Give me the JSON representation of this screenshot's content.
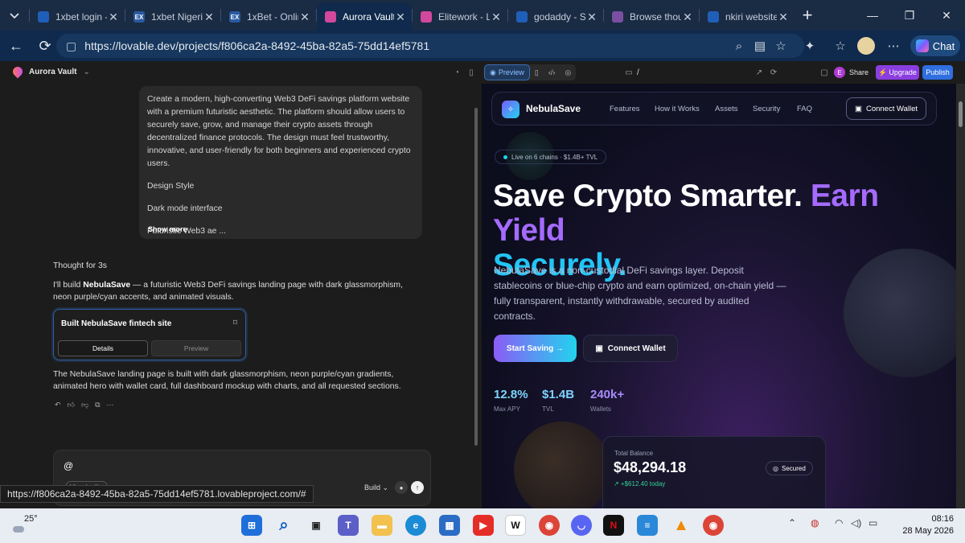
{
  "browser": {
    "tabs": [
      {
        "label": "1xbet login -",
        "fav_color": "#1f5fb8",
        "fav_text": "",
        "active": false
      },
      {
        "label": "1xbet Nigeria",
        "fav_color": "#2a5aa0",
        "fav_text": "EX",
        "active": false
      },
      {
        "label": "1xBet - Onlin",
        "fav_color": "#2a5aa0",
        "fav_text": "EX",
        "active": false
      },
      {
        "label": "Aurora Vault",
        "fav_color": "#d2489c",
        "fav_text": "",
        "active": true
      },
      {
        "label": "Elitework - Lo",
        "fav_color": "#d2489c",
        "fav_text": "",
        "active": false
      },
      {
        "label": "godaddy - Se",
        "fav_color": "#1f5fb8",
        "fav_text": "",
        "active": false
      },
      {
        "label": "Browse thous",
        "fav_color": "#7b4fa0",
        "fav_text": "",
        "active": false
      },
      {
        "label": "nkiri website",
        "fav_color": "#1f5fb8",
        "fav_text": "",
        "active": false
      }
    ],
    "url": "https://lovable.dev/projects/f806ca2a-8492-45ba-82a5-75dd14ef5781",
    "chat_label": "Chat",
    "status_url": "https://f806ca2a-8492-45ba-82a5-75dd14ef5781.lovableproject.com/#"
  },
  "app": {
    "project_name": "Aurora Vault",
    "preview_label": "Preview",
    "path": "/",
    "share_initial": "E",
    "share_label": "Share",
    "upgrade_label": "Upgrade",
    "publish_label": "Publish"
  },
  "chat": {
    "user_message": [
      "Create a modern, high-converting Web3 DeFi savings platform website with a premium futuristic aesthetic. The platform should allow users to securely save, grow, and manage their crypto assets through decentralized finance protocols. The design must feel trustworthy, innovative, and user-friendly for both beginners and experienced crypto users.",
      "Design Style",
      "Dark mode interface",
      "Futuristic Web3 ae ..."
    ],
    "show_more": "Show more",
    "thought": "Thought for 3s",
    "reply_prefix": "I'll build ",
    "reply_bold": "NebulaSave",
    "reply_rest": " — a futuristic Web3 DeFi savings landing page with dark glassmorphism, neon purple/cyan accents, and animated visuals.",
    "card_title": "Built NebulaSave fintech site",
    "card_details": "Details",
    "card_preview": "Preview",
    "summary": "The NebulaSave landing page is built with dark glassmorphism, neon purple/cyan gradients, animated hero with wallet card, full dashboard mockup with charts, and all requested sections.",
    "input_value": "@",
    "visual_edits": "Visual edits",
    "build_label": "Build"
  },
  "preview": {
    "brand": "NebulaSave",
    "nav": [
      "Features",
      "How it Works",
      "Assets",
      "Security",
      "FAQ"
    ],
    "connect_wallet": "Connect Wallet",
    "live_badge": "Live on 6 chains · $1.4B+ TVL",
    "h1_part1": "Save Crypto Smarter. ",
    "h1_part2": "Earn Yield",
    "h1_part3": "Securely.",
    "subtitle": "NebulaSave is a non-custodial DeFi savings layer. Deposit stablecoins or blue-chip crypto and earn optimized, on-chain yield — fully transparent, instantly withdrawable, secured by audited contracts.",
    "start_saving": "Start Saving →",
    "stats": [
      {
        "value": "12.8%",
        "label": "Max APY",
        "color": "#7dd3fc"
      },
      {
        "value": "$1.4B",
        "label": "TVL",
        "color": "#7dd3fc"
      },
      {
        "value": "240k+",
        "label": "Wallets",
        "color": "#a78bfa"
      }
    ],
    "balance_label": "Total Balance",
    "balance_value": "$48,294.18",
    "balance_change": "↗ +$612.40 today",
    "secured": "Secured"
  },
  "taskbar": {
    "temperature": "25°",
    "time": "08:16",
    "date": "28 May 2026"
  }
}
